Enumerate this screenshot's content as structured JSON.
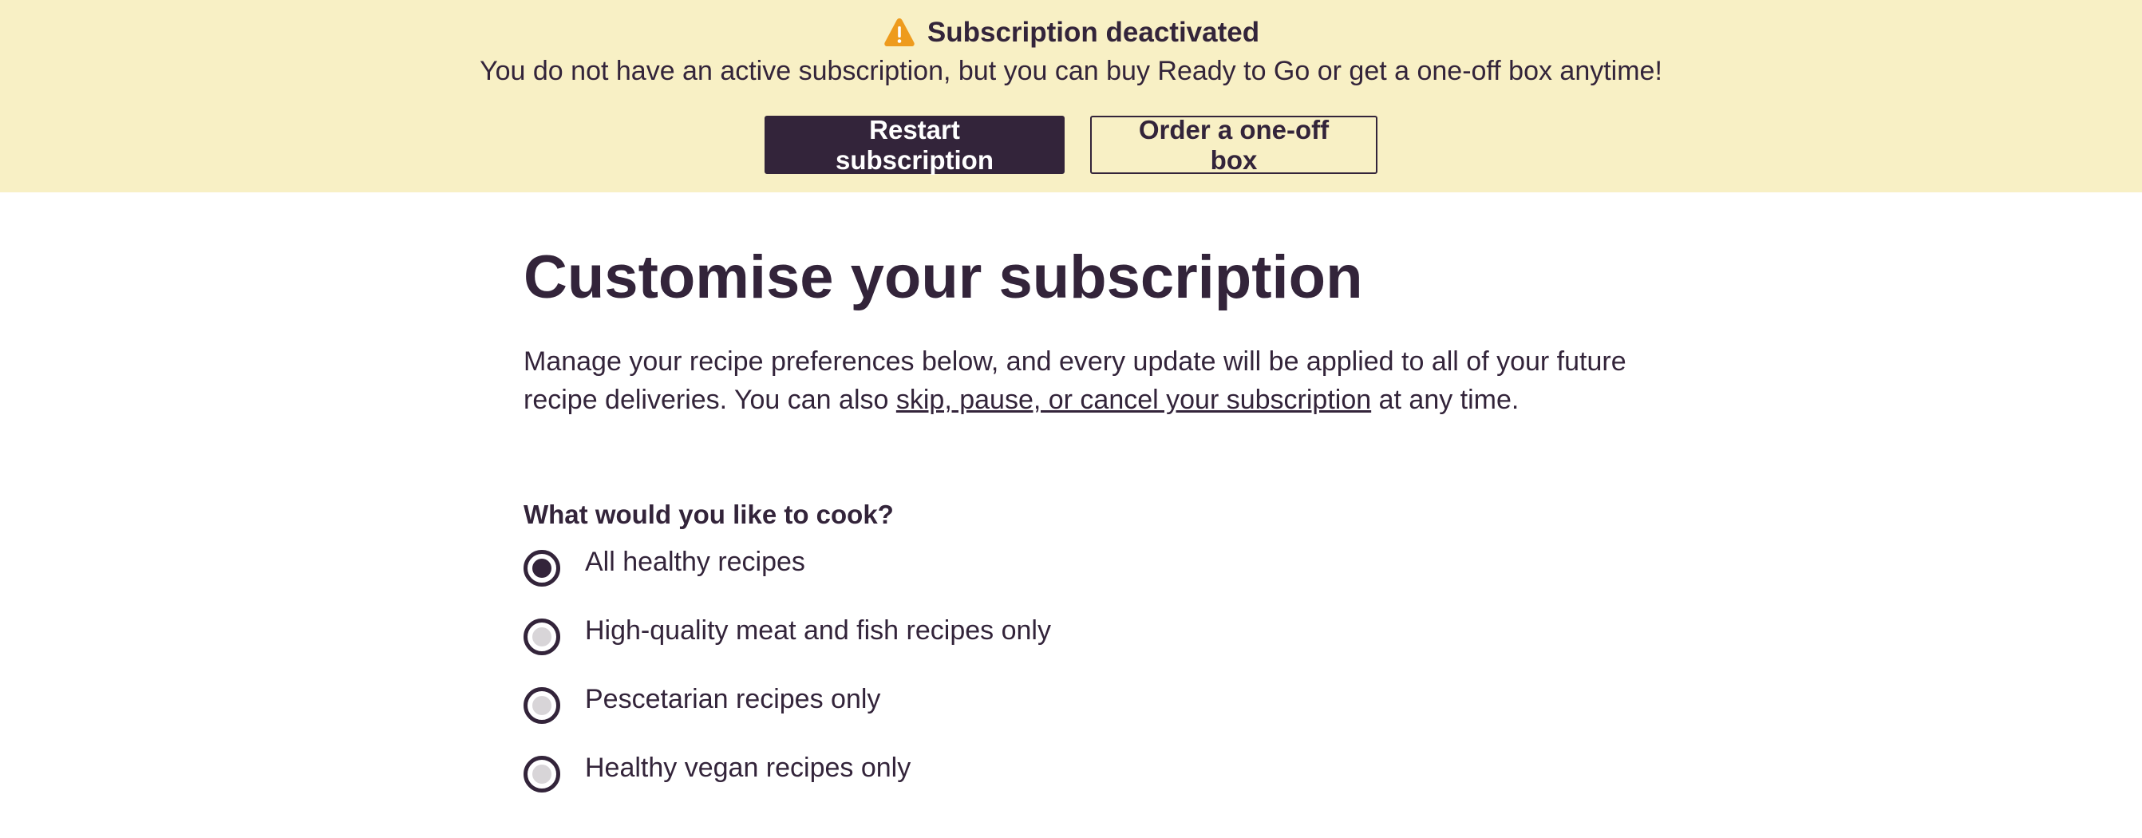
{
  "banner": {
    "icon": "warning-triangle-icon",
    "icon_color": "#ee9b1d",
    "background": "#f8f0c5",
    "title": "Subscription deactivated",
    "message": "You do not have an active subscription, but you can buy Ready to Go or get a one-off box anytime!",
    "restart_button": "Restart subscription",
    "oneoff_button": "Order a one-off box"
  },
  "main": {
    "title": "Customise your subscription",
    "intro_before": "Manage your recipe preferences below, and every update will be applied to all of your future recipe deliveries. You can also ",
    "intro_link": "skip, pause, or cancel your subscription",
    "intro_after": " at any time.",
    "question": "What would you like to cook?",
    "options": [
      {
        "label": "All healthy recipes",
        "selected": true
      },
      {
        "label": "High-quality meat and fish recipes only",
        "selected": false
      },
      {
        "label": "Pescetarian recipes only",
        "selected": false
      },
      {
        "label": "Healthy vegan recipes only",
        "selected": false
      }
    ]
  },
  "colors": {
    "text": "#33243a",
    "radio_unselected_fill": "#d8d5d8"
  }
}
